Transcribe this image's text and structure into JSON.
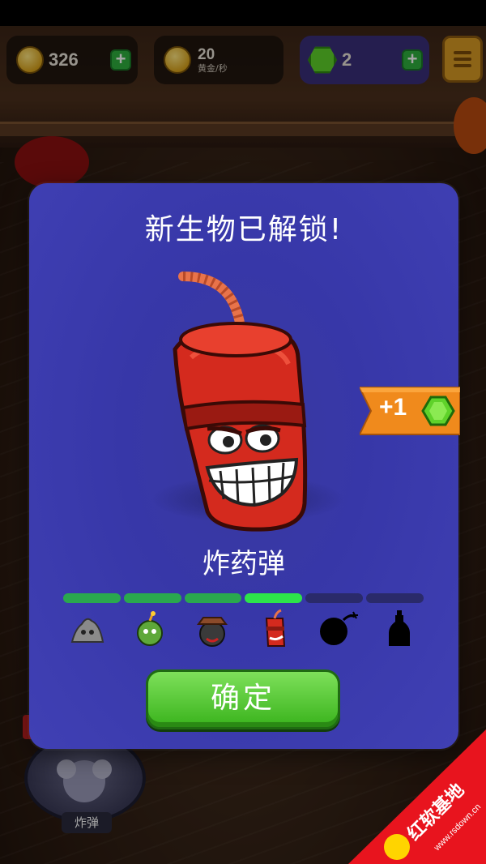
{
  "hud": {
    "coins": "326",
    "rate_value": "20",
    "rate_unit": "黄金/秒",
    "gems": "2"
  },
  "modal": {
    "title": "新生物已解锁!",
    "creature_name": "炸药弹",
    "confirm_label": "确定",
    "evolution_progress": {
      "total_stages": 6,
      "unlocked_stages": 4,
      "current_stage": 4
    },
    "evolution_icons": [
      "stone-pile-icon",
      "green-bomb-icon",
      "hat-bomb-icon",
      "dynamite-icon",
      "locked-bomb-silhouette-icon",
      "locked-bottle-silhouette-icon"
    ]
  },
  "reward": {
    "amount": "+1",
    "icon": "green-gem-icon"
  },
  "item_slot": {
    "label": "炸弹"
  },
  "watermark": {
    "site": "www.rsdown.cn",
    "brand_text": "红软基地"
  },
  "colors": {
    "modal_bg": "#3a3aa8",
    "progress_done": "#2aa84e",
    "progress_current": "#2de44a",
    "progress_locked": "#2a2a6a",
    "confirm_green": "#4cc22a",
    "ribbon_orange": "#f08a1c",
    "gem_green": "#5fd22a"
  }
}
